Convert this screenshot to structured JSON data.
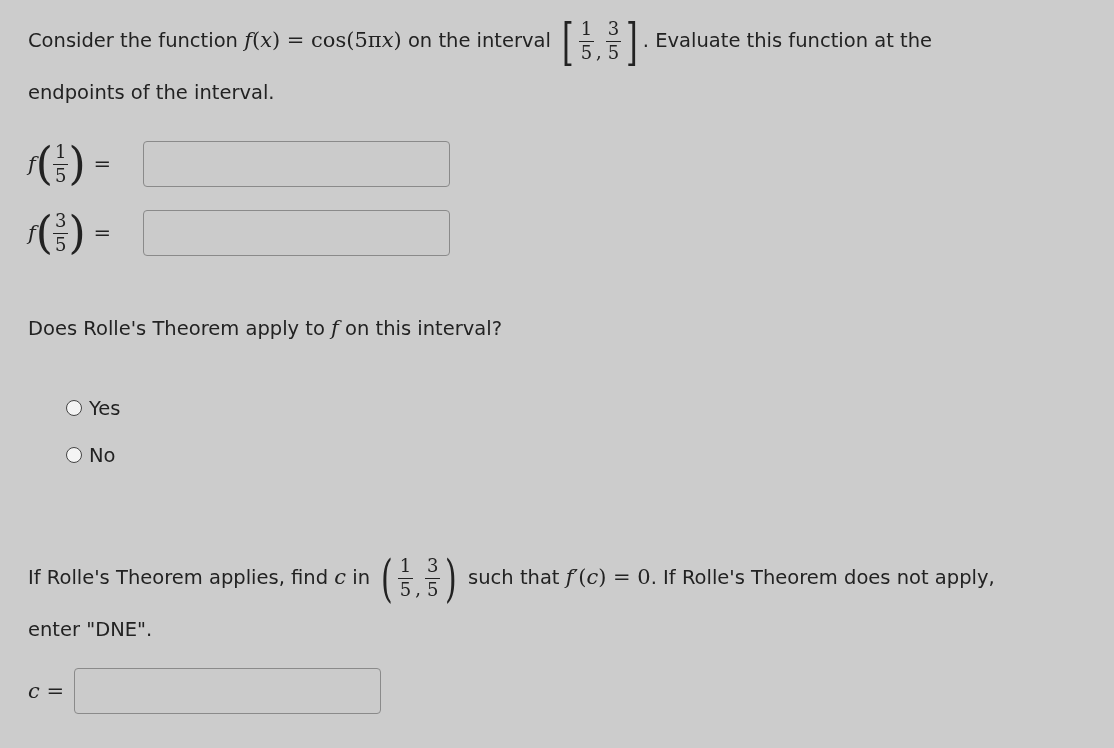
{
  "intro": {
    "parts": [
      {
        "kind": "text",
        "text": "Consider the function "
      },
      {
        "kind": "math",
        "text": "*f*(*x*) = cos(5π"
      },
      {
        "kind": "var",
        "text": "x"
      },
      {
        "kind": "math",
        "text": ")"
      },
      {
        "kind": "text",
        "text": " on the interval "
      },
      {
        "kind": "group",
        "open": "[",
        "close": "]",
        "separator": ",",
        "items": [
          {
            "num": "1",
            "den": "5"
          },
          {
            "num": "3",
            "den": "5"
          }
        ]
      },
      {
        "kind": "text",
        "text": ". Evaluate this function at the endpoints of the interval."
      }
    ]
  },
  "answers": [
    {
      "fn": "f",
      "open": "(",
      "close": ")",
      "num": "1",
      "den": "5",
      "eq": "="
    },
    {
      "fn": "f",
      "open": "(",
      "close": ")",
      "num": "3",
      "den": "5",
      "eq": "="
    }
  ],
  "question": {
    "parts": [
      {
        "kind": "text",
        "text": "Does Rolle's Theorem apply to "
      },
      {
        "kind": "math",
        "text": "*f*"
      },
      {
        "kind": "text",
        "text": " on this interval?"
      }
    ]
  },
  "options": [
    {
      "label": "Yes",
      "selected": false
    },
    {
      "label": "No",
      "selected": false
    }
  ],
  "instruction": {
    "parts": [
      {
        "kind": "text",
        "text": "If Rolle's Theorem applies, find "
      },
      {
        "kind": "math",
        "text": "*c*"
      },
      {
        "kind": "text",
        "text": " in "
      },
      {
        "kind": "group",
        "open": "(",
        "close": ")",
        "separator": ",",
        "items": [
          {
            "num": "1",
            "den": "5"
          },
          {
            "num": "3",
            "den": "5"
          }
        ]
      },
      {
        "kind": "text",
        "text": " such that "
      },
      {
        "kind": "math",
        "text": "*f*′(*c*) = 0"
      },
      {
        "kind": "text",
        "text": ". If Rolle's Theorem does not apply, enter \"DNE\"."
      }
    ]
  },
  "final_answer": {
    "label": "*c* ="
  }
}
